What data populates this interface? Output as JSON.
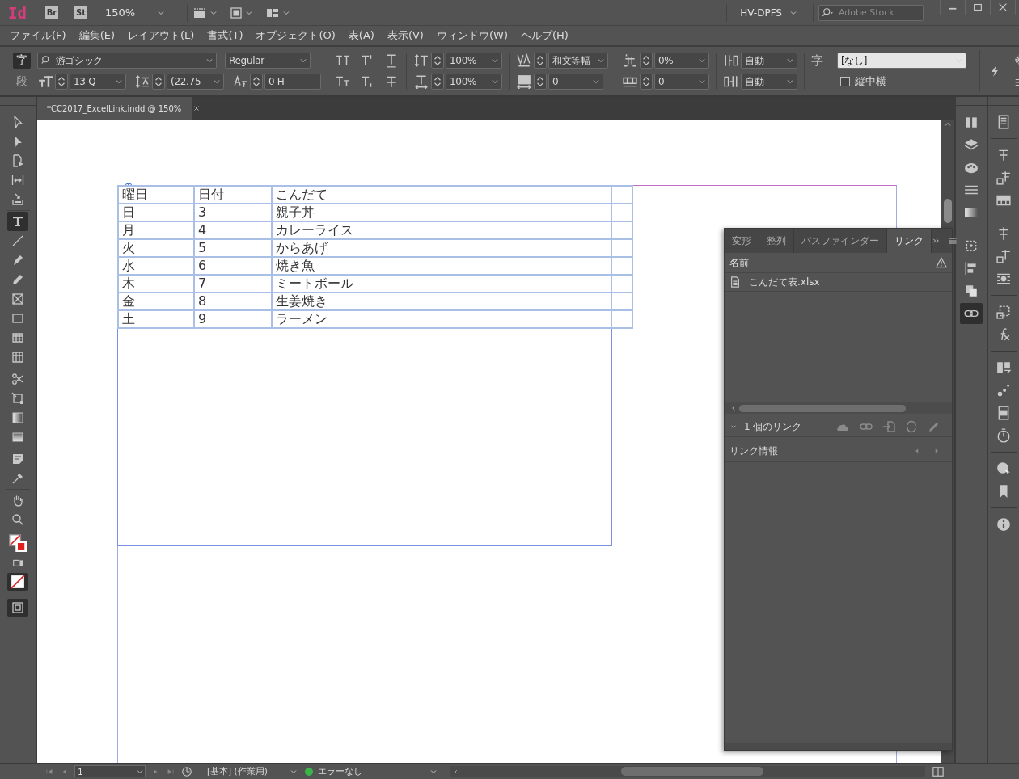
{
  "app_bar": {
    "logo": "Id",
    "bridge": "Br",
    "stock": "St",
    "zoom": "150%",
    "workspace": "HV-DPFS",
    "search": {
      "placeholder": "Adobe Stock"
    }
  },
  "menu": [
    "ファイル(F)",
    "編集(E)",
    "レイアウト(L)",
    "書式(T)",
    "オブジェクト(O)",
    "表(A)",
    "表示(V)",
    "ウィンドウ(W)",
    "ヘルプ(H)"
  ],
  "control_panel": {
    "mode_tabs": [
      {
        "label": "字",
        "selected": true
      },
      {
        "label": "段",
        "selected": false
      }
    ],
    "font_family": "游ゴシック",
    "font_style": "Regular",
    "font_size": "13 Q",
    "leading": "(22.75",
    "baseline_shift": "0 H",
    "vertical_scale": "100%",
    "horizontal_scale": "100%",
    "kerning": "和文等幅",
    "tracking": "0",
    "tsume": "0%",
    "aki": "0",
    "mojikumi_before": "自動",
    "mojikumi_after": "自動",
    "char_style_label": "字",
    "char_style": "[なし]",
    "tate_chu_yoko": {
      "label": "縦中横",
      "checked": false
    }
  },
  "tools": [
    {
      "kind": "direct-select",
      "selected": false
    },
    {
      "kind": "select",
      "selected": false
    },
    {
      "kind": "page",
      "selected": false
    },
    {
      "kind": "gap",
      "selected": false
    },
    {
      "kind": "collector",
      "selected": false
    },
    {
      "kind": "type",
      "selected": true
    },
    {
      "kind": "line",
      "selected": false
    },
    {
      "kind": "pen",
      "selected": false
    },
    {
      "kind": "pencil",
      "selected": false
    },
    {
      "kind": "frame",
      "selected": false
    },
    {
      "kind": "rectangle",
      "selected": false
    },
    {
      "kind": "table",
      "selected": false
    },
    {
      "kind": "table-vertical",
      "selected": false
    },
    {
      "kind": "scissors",
      "selected": false
    },
    {
      "kind": "transform",
      "selected": false
    },
    {
      "kind": "gradient",
      "selected": false
    },
    {
      "kind": "feather",
      "selected": false
    },
    {
      "kind": "note",
      "selected": false
    },
    {
      "kind": "eyedropper",
      "selected": false
    },
    {
      "kind": "hand",
      "selected": false
    },
    {
      "kind": "zoom",
      "selected": false
    }
  ],
  "document_tab": {
    "title": "*CC2017_ExcelLink.indd @ 150%"
  },
  "table": {
    "rows": [
      [
        "曜日",
        "日付",
        "こんだて"
      ],
      [
        "日",
        "3",
        "親子丼"
      ],
      [
        "月",
        "4",
        "カレーライス"
      ],
      [
        "火",
        "5",
        "からあげ"
      ],
      [
        "水",
        "6",
        "焼き魚"
      ],
      [
        "木",
        "7",
        "ミートボール"
      ],
      [
        "金",
        "8",
        "生姜焼き"
      ],
      [
        "土",
        "9",
        "ラーメン"
      ]
    ]
  },
  "links_panel": {
    "tabs": [
      {
        "label": "変形",
        "selected": false
      },
      {
        "label": "整列",
        "selected": false
      },
      {
        "label": "パスファインダー",
        "selected": false
      },
      {
        "label": "リンク",
        "selected": true
      }
    ],
    "column_name": "名前",
    "links": [
      {
        "name": "こんだて表.xlsx"
      }
    ],
    "count": "1 個のリンク",
    "info_title": "リンク情報"
  },
  "dock": [
    {
      "kind": "pages",
      "selected": false
    },
    {
      "kind": "layers",
      "selected": false
    },
    {
      "kind": "swatches",
      "selected": false
    },
    {
      "kind": "stroke",
      "selected": false
    },
    {
      "kind": "gradient",
      "selected": false
    },
    {
      "kind": "transform",
      "selected": false
    },
    {
      "kind": "align",
      "selected": false
    },
    {
      "kind": "pathfinder",
      "selected": false
    },
    {
      "kind": "links",
      "selected": true
    }
  ],
  "status_bar": {
    "page": "1",
    "preflight_profile": "[基本] (作業用)",
    "preflight_status": "エラーなし",
    "preflight_ok": true
  }
}
